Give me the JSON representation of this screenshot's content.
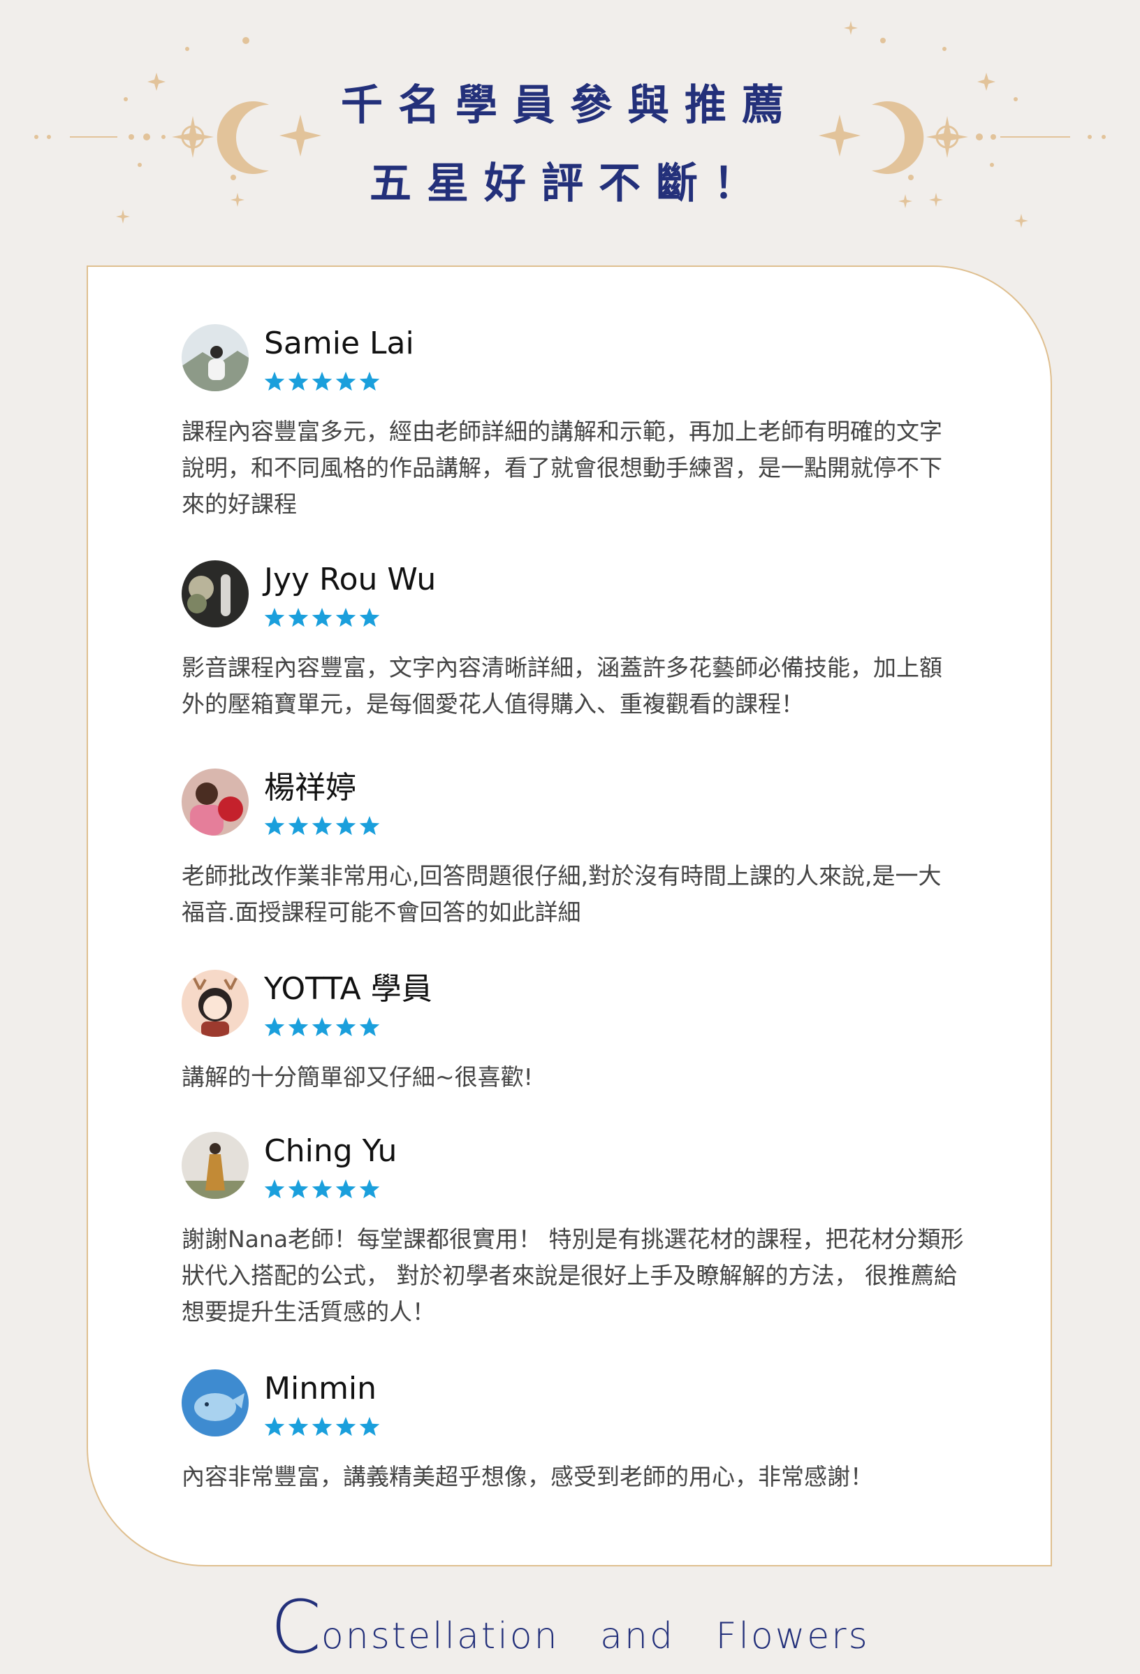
{
  "header": {
    "title_line1": "千名學員參與推薦",
    "title_line2": "五星好評不斷！"
  },
  "colors": {
    "title": "#23307a",
    "gold": "#e2c39a",
    "star": "#1a9fdc",
    "card_border": "#dfbf8f"
  },
  "reviews": [
    {
      "name": "Samie Lai",
      "rating": 5,
      "avatar": "mountain-portrait-avatar",
      "text": "課程內容豐富多元，經由老師詳細的講解和示範，再加上老師有明確的文字說明，和不同風格的作品講解，看了就會很想動手練習，是一點開就停不下來的好課程"
    },
    {
      "name": "Jyy Rou Wu",
      "rating": 5,
      "avatar": "flowers-dark-avatar",
      "text": "影音課程內容豐富，文字內容清晰詳細，涵蓋許多花藝師必備技能，加上額外的壓箱寶單元，是每個愛花人值得購入、重複觀看的課程！"
    },
    {
      "name": "楊祥婷",
      "rating": 5,
      "avatar": "woman-red-fan-avatar",
      "text": "老師批改作業非常用心,回答問題很仔細,對於沒有時間上課的人來說,是一大福音.面授課程可能不會回答的如此詳細"
    },
    {
      "name": "YOTTA 學員",
      "rating": 5,
      "avatar": "cartoon-deer-girl-avatar",
      "text": "講解的十分簡單卻又仔細~很喜歡!"
    },
    {
      "name": "Ching Yu",
      "rating": 5,
      "avatar": "woman-standing-avatar",
      "text": "謝謝Nana老師！每堂課都很實用！ 特別是有挑選花材的課程，把花材分類形狀代入搭配的公式， 對於初學者來說是很好上手及瞭解解的方法， 很推薦給想要提升生活質感的人！"
    },
    {
      "name": "Minmin",
      "rating": 5,
      "avatar": "blue-whale-avatar",
      "text": "內容非常豐富，講義精美超乎想像，感受到老師的用心，非常感謝！"
    }
  ],
  "footer": {
    "initial": "C",
    "rest": "onstellation   and   Flowers"
  }
}
